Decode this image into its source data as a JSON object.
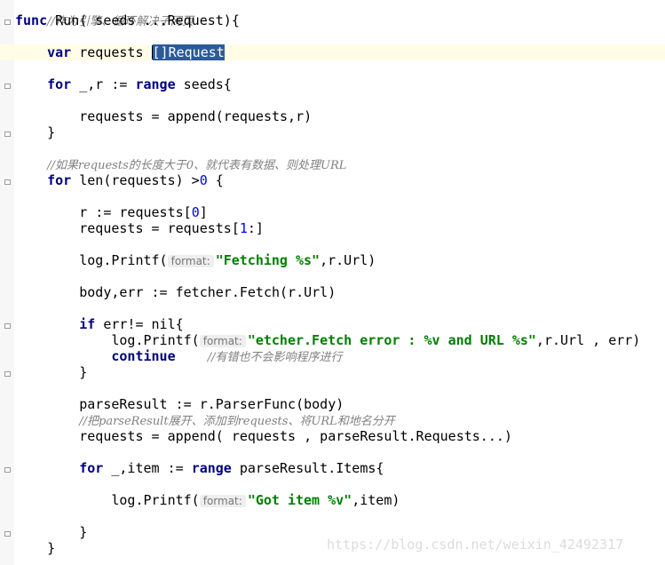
{
  "editor": {
    "lines": {
      "l1": "//作为引擎、循环解决子网页",
      "l2_func": "func",
      "l2_rest": " Run( seeds ...Request){",
      "l4_var": "var",
      "l4_rest": " requests ",
      "l4_sel": "[]Request",
      "l6_for": "for",
      "l6_mid": " _,r := ",
      "l6_range": "range",
      "l6_end": " seeds{",
      "l8": "requests = append(requests,r)",
      "l9": "}",
      "l11": "//如果requests的长度大于0、就代表有数据、则处理URL",
      "l12_for": "for",
      "l12_mid": " len(requests) >",
      "l12_num": "0",
      "l12_end": " {",
      "l14": "r := requests[",
      "l14_num": "0",
      "l14_end": "]",
      "l15": "requests = requests[",
      "l15_num": "1",
      "l15_end": ":]",
      "l17_a": "log.Printf(",
      "l17_hint": "format:",
      "l17_str": "\"Fetching %s\"",
      "l17_end": ",r.Url)",
      "l19": "body,err := fetcher.Fetch(r.Url)",
      "l21_if": "if",
      "l21_rest": " err!= nil{",
      "l22_a": "log.Printf(",
      "l22_hint": "format:",
      "l22_str": "\"etcher.Fetch error : %v and URL %s\"",
      "l22_end": ",r.Url , err)",
      "l23_kw": "continue",
      "l23_cmt": "//有错也不会影响程序进行",
      "l24": "}",
      "l26": "parseResult := r.ParserFunc(body)",
      "l27": "//把parseResult展开、添加到requests、将URL和地名分开",
      "l28": "requests = append( requests , parseResult.Requests...)",
      "l30_for": "for",
      "l30_mid": " _,item := ",
      "l30_range": "range",
      "l30_end": " parseResult.Items{",
      "l32_a": "log.Printf(",
      "l32_hint": "format:",
      "l32_str": "\"Got item %v\"",
      "l32_end": ",item)",
      "l34": "}",
      "l35": "}"
    }
  },
  "watermark": "https://blog.csdn.net/weixin_42492317",
  "colors": {
    "keyword": "#000080",
    "string": "#008000",
    "number": "#0000ff",
    "comment": "#808080",
    "selection": "#2d5a98",
    "current_line": "#fffde6"
  }
}
